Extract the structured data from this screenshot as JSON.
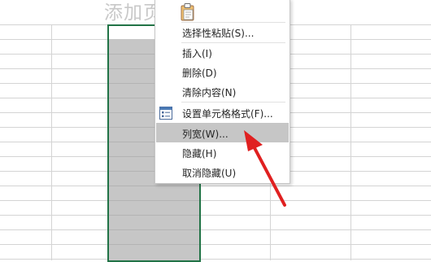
{
  "page": {
    "watermark": "添加页"
  },
  "context_menu": {
    "paste_icon": "clipboard-icon",
    "items": [
      {
        "label": "选择性粘贴(S)...",
        "id": "paste-special"
      },
      {
        "label": "插入(I)",
        "id": "insert"
      },
      {
        "label": "删除(D)",
        "id": "delete"
      },
      {
        "label": "清除内容(N)",
        "id": "clear-contents"
      },
      {
        "label": "设置单元格格式(F)...",
        "id": "format-cells",
        "icon": "format-cells-icon"
      },
      {
        "label": "列宽(W)...",
        "id": "column-width",
        "highlighted": true
      },
      {
        "label": "隐藏(H)",
        "id": "hide"
      },
      {
        "label": "取消隐藏(U)",
        "id": "unhide"
      }
    ]
  },
  "colors": {
    "selection_border": "#217346",
    "selection_fill": "#c6c6c6",
    "menu_highlight": "#c6c6c6",
    "annotation_arrow": "#e02020"
  }
}
